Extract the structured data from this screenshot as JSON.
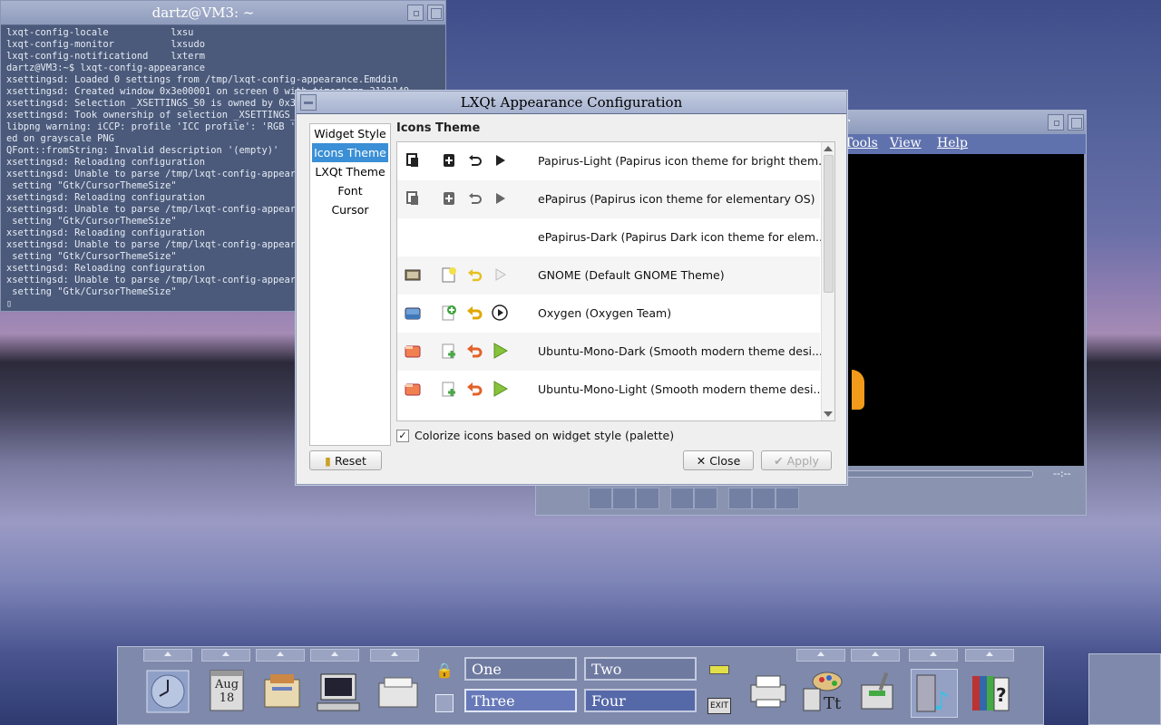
{
  "terminal": {
    "title": "dartz@VM3: ~",
    "lines": [
      "lxqt-config-locale           lxsu",
      "lxqt-config-monitor          lxsudo",
      "lxqt-config-notificationd    lxterm",
      "dartz@VM3:~$ lxqt-config-appearance",
      "xsettingsd: Loaded 0 settings from /tmp/lxqt-config-appearance.Emddin",
      "xsettingsd: Created window 0x3e00001 on screen 0 with timestamp 3129149",
      "xsettingsd: Selection _XSETTINGS_S0 is owned by 0x300",
      "xsettingsd: Took ownership of selection _XSETTINGS_S0",
      "libpng warning: iCCP: profile 'ICC profile': 'RGB ':",
      "ed on grayscale PNG",
      "QFont::fromString: Invalid description '(empty)'",
      "xsettingsd: Reloading configuration",
      "xsettingsd: Unable to parse /tmp/lxqt-config-appearan",
      " setting \"Gtk/CursorThemeSize\"",
      "xsettingsd: Reloading configuration",
      "xsettingsd: Unable to parse /tmp/lxqt-config-appearan",
      " setting \"Gtk/CursorThemeSize\"",
      "xsettingsd: Reloading configuration",
      "xsettingsd: Unable to parse /tmp/lxqt-config-appearan",
      " setting \"Gtk/CursorThemeSize\"",
      "xsettingsd: Reloading configuration",
      "xsettingsd: Unable to parse /tmp/lxqt-config-appearan",
      " setting \"Gtk/CursorThemeSize\"",
      "▯"
    ]
  },
  "player": {
    "title_fragment": "er",
    "menu": {
      "tools": "Tools",
      "view": "View",
      "help": "Help"
    },
    "time": "--:--"
  },
  "dialog": {
    "title": "LXQt Appearance Configuration",
    "sidebar": [
      "Widget Style",
      "Icons Theme",
      "LXQt Theme",
      "Font",
      "Cursor"
    ],
    "selected_sidebar": "Icons Theme",
    "section_title": "Icons Theme",
    "themes": [
      {
        "name": "Papirus-Light (Papirus icon theme for bright them...",
        "style": "papirus"
      },
      {
        "name": "ePapirus (Papirus icon theme for elementary OS)",
        "style": "papirus-dim"
      },
      {
        "name": "ePapirus-Dark (Papirus Dark icon theme for elem...",
        "style": "none"
      },
      {
        "name": "GNOME (Default GNOME Theme)",
        "style": "gnome"
      },
      {
        "name": "Oxygen (Oxygen Team)",
        "style": "oxygen"
      },
      {
        "name": "Ubuntu-Mono-Dark (Smooth modern theme desi...",
        "style": "ubuntu"
      },
      {
        "name": "Ubuntu-Mono-Light (Smooth modern theme desi...",
        "style": "ubuntu"
      }
    ],
    "colorize_label": "Colorize icons based on widget style (palette)",
    "colorize_checked": true,
    "buttons": {
      "reset": "Reset",
      "close": "Close",
      "apply": "Apply"
    }
  },
  "panel": {
    "date": {
      "month": "Aug",
      "day": "18"
    },
    "workspaces": [
      "One",
      "Two",
      "Three",
      "Four"
    ],
    "selected_workspace": "Three",
    "exit_label": "EXIT"
  }
}
